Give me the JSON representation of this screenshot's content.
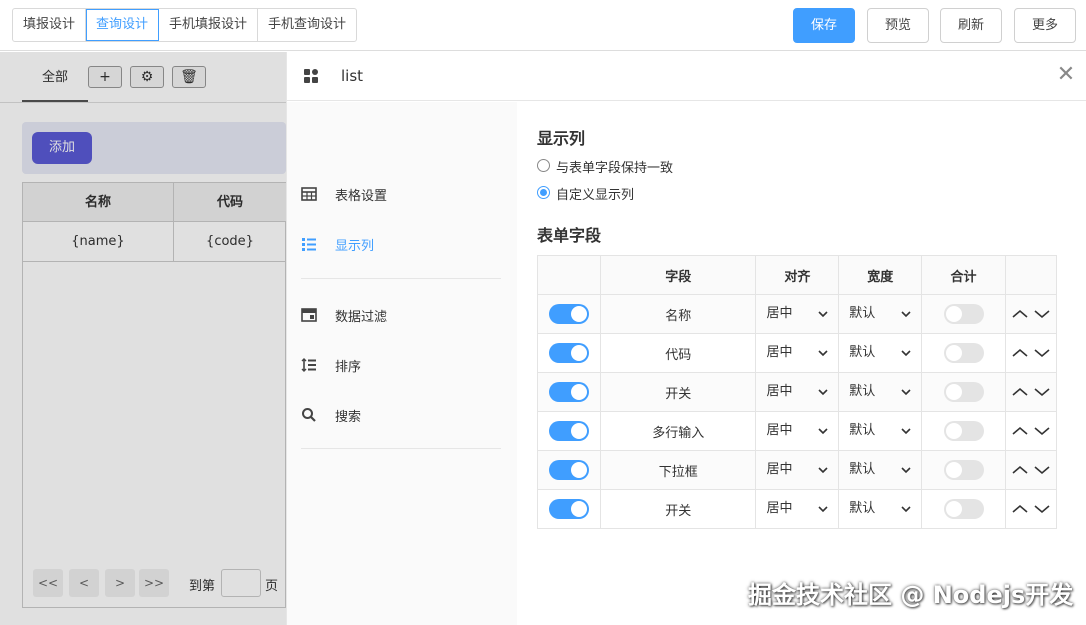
{
  "top_tabs": [
    {
      "label": "填报设计",
      "active": false
    },
    {
      "label": "查询设计",
      "active": true
    },
    {
      "label": "手机填报设计",
      "active": false
    },
    {
      "label": "手机查询设计",
      "active": false
    }
  ],
  "top_buttons": {
    "save": "保存",
    "preview": "预览",
    "refresh": "刷新",
    "more": "更多"
  },
  "background": {
    "tab_all": "全部",
    "add_button": "添加",
    "table_headers": [
      "名称",
      "代码"
    ],
    "table_row": [
      "{name}",
      "{code}"
    ],
    "pager": {
      "first": "<<",
      "prev": "<",
      "next": ">",
      "last": ">>",
      "goto_label": "到第",
      "page_label": "页"
    }
  },
  "drawer": {
    "title": "list",
    "nav": [
      {
        "label": "表格设置",
        "icon": "table-icon",
        "active": false
      },
      {
        "label": "显示列",
        "icon": "columns-icon",
        "active": true
      },
      {
        "label": "数据过滤",
        "icon": "filter-icon",
        "active": false
      },
      {
        "label": "排序",
        "icon": "sort-icon",
        "active": false
      },
      {
        "label": "搜索",
        "icon": "search-icon",
        "active": false
      }
    ],
    "display_section": {
      "heading": "显示列",
      "options": [
        {
          "label": "与表单字段保持一致",
          "checked": false
        },
        {
          "label": "自定义显示列",
          "checked": true
        }
      ]
    },
    "fields_section": {
      "heading": "表单字段",
      "columns": [
        "",
        "字段",
        "对齐",
        "宽度",
        "合计",
        ""
      ],
      "rows": [
        {
          "visible": true,
          "field": "名称",
          "align": "居中",
          "width": "默认",
          "sum": false
        },
        {
          "visible": true,
          "field": "代码",
          "align": "居中",
          "width": "默认",
          "sum": false
        },
        {
          "visible": true,
          "field": "开关",
          "align": "居中",
          "width": "默认",
          "sum": false
        },
        {
          "visible": true,
          "field": "多行输入",
          "align": "居中",
          "width": "默认",
          "sum": false
        },
        {
          "visible": true,
          "field": "下拉框",
          "align": "居中",
          "width": "默认",
          "sum": false
        },
        {
          "visible": true,
          "field": "开关",
          "align": "居中",
          "width": "默认",
          "sum": false
        }
      ]
    }
  },
  "watermark": "掘金技术社区 @ Nodejs开发",
  "colors": {
    "accent": "#409eff",
    "add_button": "#5b5bd6"
  }
}
